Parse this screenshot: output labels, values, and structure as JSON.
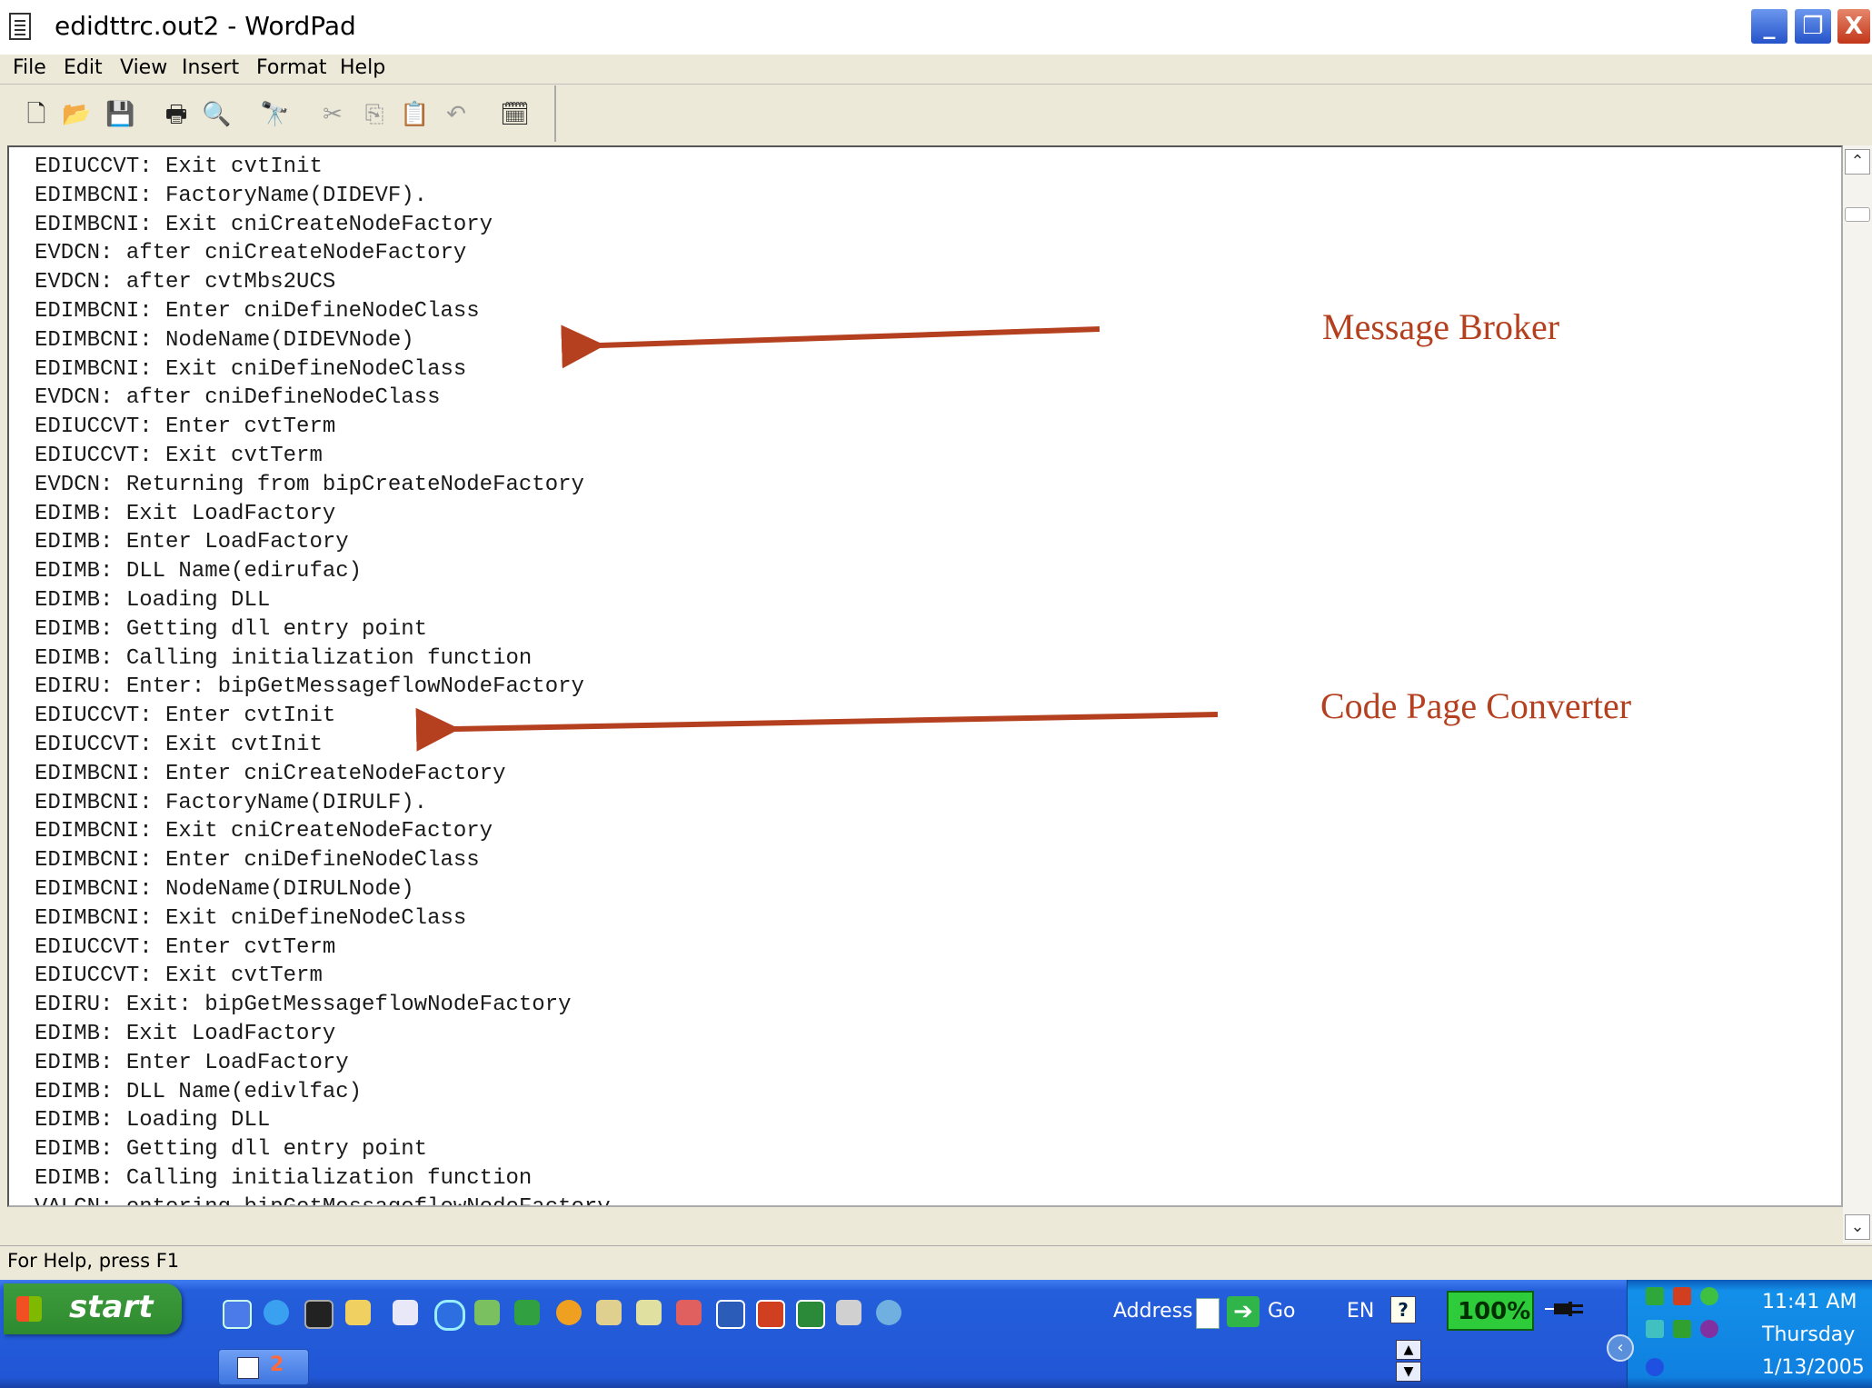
{
  "window": {
    "title": "edidttrc.out2 - WordPad",
    "minimize_glyph": "_",
    "maximize_glyph": "❐",
    "close_glyph": "X"
  },
  "menu": [
    "File",
    "Edit",
    "View",
    "Insert",
    "Format",
    "Help"
  ],
  "toolbar": {
    "icons": [
      "new-document-icon",
      "open-folder-icon",
      "save-icon",
      "print-icon",
      "print-preview-icon",
      "find-icon",
      "cut-icon",
      "copy-icon",
      "paste-icon",
      "undo-icon",
      "insert-date-time-icon"
    ]
  },
  "document": {
    "lines": [
      "EDIUCCVT: Exit cvtInit",
      "EDIMBCNI: FactoryName(DIDEVF).",
      "EDIMBCNI: Exit cniCreateNodeFactory",
      "EVDCN: after cniCreateNodeFactory",
      "EVDCN: after cvtMbs2UCS",
      "EDIMBCNI: Enter cniDefineNodeClass",
      "EDIMBCNI: NodeName(DIDEVNode)",
      "EDIMBCNI: Exit cniDefineNodeClass",
      "EVDCN: after cniDefineNodeClass",
      "EDIUCCVT: Enter cvtTerm",
      "EDIUCCVT: Exit cvtTerm",
      "EVDCN: Returning from bipCreateNodeFactory",
      "EDIMB: Exit LoadFactory",
      "EDIMB: Enter LoadFactory",
      "EDIMB: DLL Name(edirufac)",
      "EDIMB: Loading DLL",
      "EDIMB: Getting dll entry point",
      "EDIMB: Calling initialization function",
      "EDIRU: Enter: bipGetMessageflowNodeFactory",
      "EDIUCCVT: Enter cvtInit",
      "EDIUCCVT: Exit cvtInit",
      "EDIMBCNI: Enter cniCreateNodeFactory",
      "EDIMBCNI: FactoryName(DIRULF).",
      "EDIMBCNI: Exit cniCreateNodeFactory",
      "EDIMBCNI: Enter cniDefineNodeClass",
      "EDIMBCNI: NodeName(DIRULNode)",
      "EDIMBCNI: Exit cniDefineNodeClass",
      "EDIUCCVT: Enter cvtTerm",
      "EDIUCCVT: Exit cvtTerm",
      "EDIRU: Exit: bipGetMessageflowNodeFactory",
      "EDIMB: Exit LoadFactory",
      "EDIMB: Enter LoadFactory",
      "EDIMB: DLL Name(edivlfac)",
      "EDIMB: Loading DLL",
      "EDIMB: Getting dll entry point",
      "EDIMB: Calling initialization function",
      "VALCN: entering bipGetMessageflowNodeFactory"
    ]
  },
  "annotations": {
    "message_broker": "Message Broker",
    "code_page_converter": "Code Page Converter",
    "color": "#b5401f"
  },
  "status_bar": {
    "text": "For Help, press F1"
  },
  "taskbar": {
    "start_label": "start",
    "task_count": "2",
    "address_label": "Address",
    "go_label": "Go",
    "language": "EN",
    "help_glyph": "?",
    "zoom": "100%",
    "clock": {
      "time": "11:41 AM",
      "day": "Thursday",
      "date": "1/13/2005"
    }
  }
}
